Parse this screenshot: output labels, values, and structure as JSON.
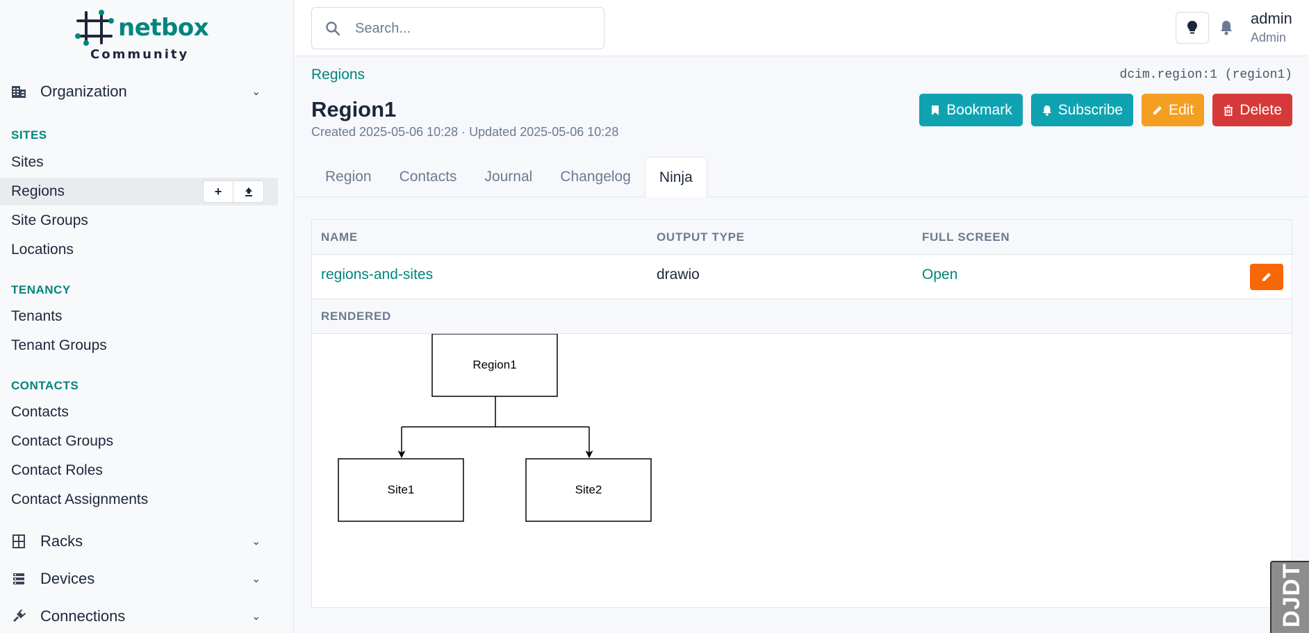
{
  "logo": {
    "word": "netbox",
    "sub": "Community"
  },
  "sidebar": {
    "organization_label": "Organization",
    "sections": {
      "sites": "SITES",
      "tenancy": "TENANCY",
      "contacts": "CONTACTS"
    },
    "items": {
      "sites": "Sites",
      "regions": "Regions",
      "site_groups": "Site Groups",
      "locations": "Locations",
      "tenants": "Tenants",
      "tenant_groups": "Tenant Groups",
      "contacts": "Contacts",
      "contact_groups": "Contact Groups",
      "contact_roles": "Contact Roles",
      "contact_assignments": "Contact Assignments"
    },
    "groups": {
      "racks": "Racks",
      "devices": "Devices",
      "connections": "Connections"
    },
    "regions_actions": {
      "add": "+",
      "import": "⬆"
    }
  },
  "header": {
    "search_placeholder": "Search...",
    "user_name": "admin",
    "user_role": "Admin"
  },
  "page": {
    "breadcrumb": "Regions",
    "object_id": "dcim.region:1 (region1)",
    "title": "Region1",
    "meta": "Created 2025-05-06 10:28 · Updated 2025-05-06 10:28",
    "actions": {
      "bookmark": "Bookmark",
      "subscribe": "Subscribe",
      "edit": "Edit",
      "delete": "Delete"
    },
    "tabs": [
      "Region",
      "Contacts",
      "Journal",
      "Changelog",
      "Ninja"
    ],
    "active_tab": "Ninja"
  },
  "table": {
    "headers": {
      "name": "NAME",
      "output_type": "OUTPUT TYPE",
      "full_screen": "FULL SCREEN"
    },
    "row": {
      "name": "regions-and-sites",
      "output_type": "drawio",
      "full_screen": "Open"
    },
    "rendered_header": "RENDERED"
  },
  "diagram": {
    "root": "Region1",
    "children": [
      "Site1",
      "Site2"
    ]
  },
  "debug_toolbar": "DJDT",
  "colors": {
    "accent": "#00857d",
    "bookmark": "#0fa3b1",
    "edit": "#f59f22",
    "delete": "#d63939",
    "row_edit": "#f76707"
  }
}
